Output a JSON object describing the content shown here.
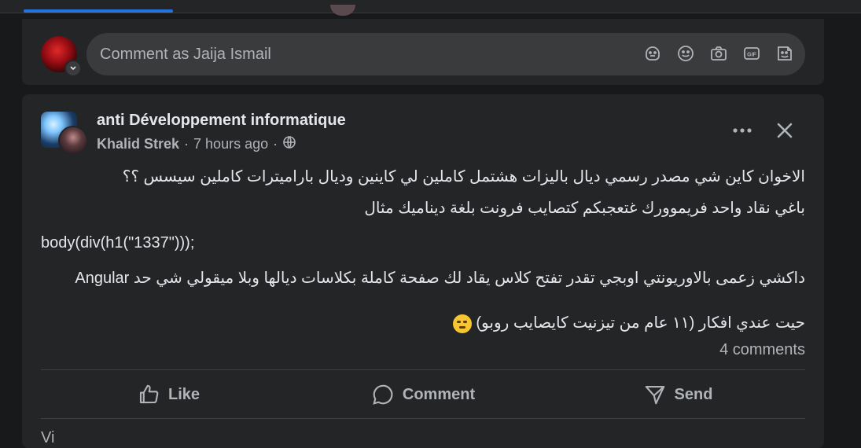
{
  "comment_box": {
    "placeholder": "Comment as Jaija Ismail"
  },
  "post": {
    "group_name": "anti Développement informatique",
    "author": "Khalid Strek",
    "time": "7 hours ago",
    "separator": "·",
    "lines": [
      "الاخوان كاين شي مصدر رسمي ديال باليزات هشتمل كاملين لي كاينين وديال باراميترات كاملين سيسس ؟؟",
      "باغي نقاد واحد فريموورك غتعجبكم كتصايب فرونت بلغة ديناميك مثال",
      "body(div(h1(\"1337\")));",
      "داكشي زعمى بالاوريونتي اوبجي تقدر تفتح كلاس يقاد لك صفحة كاملة بكلاسات ديالها وبلا ميقولي شي حد Angular",
      "حيت عندي افكار (١١ عام من تيزنيت كايصايب روبو)"
    ],
    "comments_count": "4 comments",
    "actions": {
      "like": "Like",
      "comment": "Comment",
      "send": "Send"
    },
    "next_snippet": "Vi"
  },
  "colors": {
    "background": "#18191a",
    "card": "#242526",
    "input": "#3a3b3c",
    "accent": "#2374e1",
    "text_primary": "#e4e6eb",
    "text_secondary": "#b0b3b8"
  }
}
